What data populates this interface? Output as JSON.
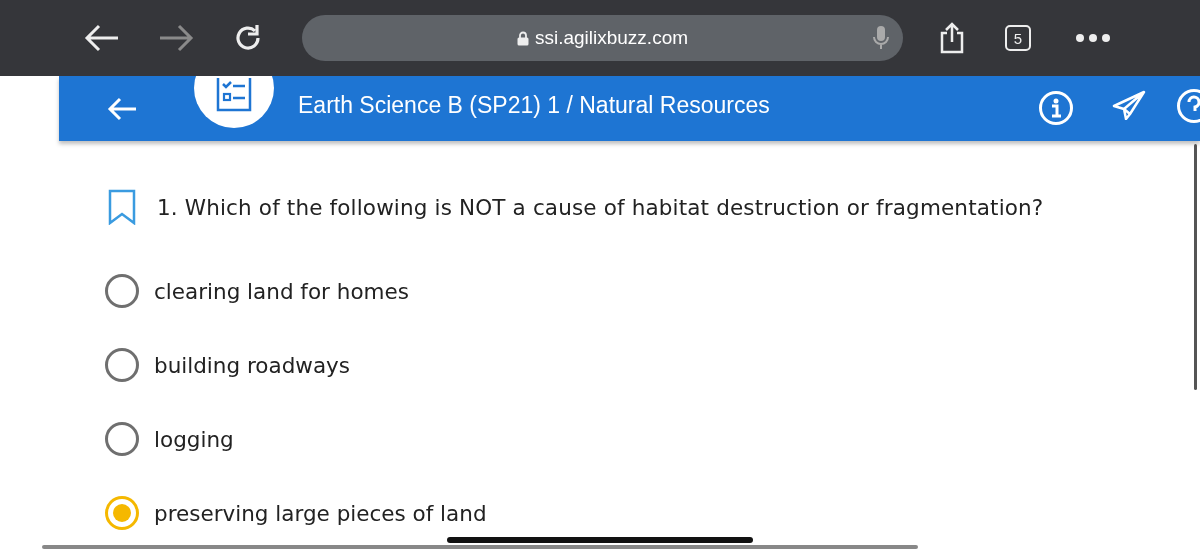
{
  "browser": {
    "url": "ssi.agilixbuzz.com",
    "tab_count": "5"
  },
  "header": {
    "subtitle": "Earth Science B (SP21) 1 / Natural Resources"
  },
  "question": {
    "text": "1. Which of the following is NOT a cause of habitat destruction or fragmentation?",
    "bookmarked": false
  },
  "options": [
    {
      "label": "clearing land for homes",
      "selected": false
    },
    {
      "label": "building roadways",
      "selected": false
    },
    {
      "label": "logging",
      "selected": false
    },
    {
      "label": "preserving large pieces of land",
      "selected": true
    }
  ]
}
